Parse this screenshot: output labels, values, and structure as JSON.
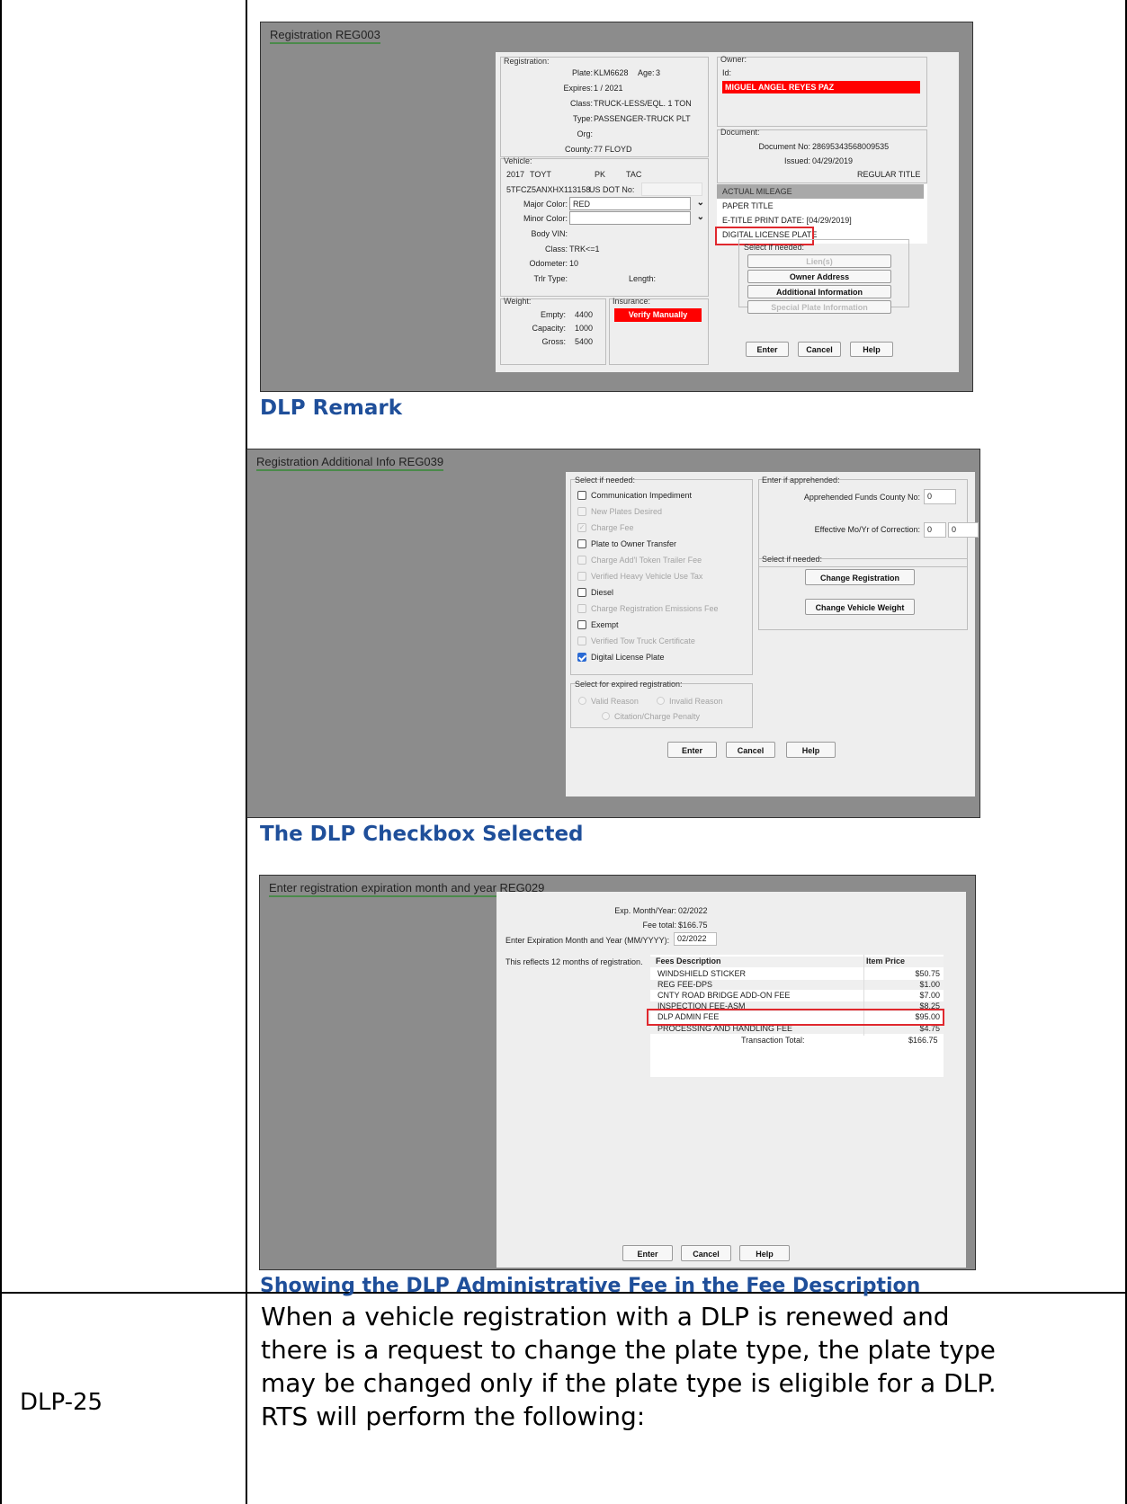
{
  "ss1": {
    "title": "Registration REG003",
    "registration": {
      "label": "Registration:",
      "plate_lbl": "Plate:",
      "plate": "KLM6628",
      "age_lbl": "Age:",
      "age": "3",
      "expires_lbl": "Expires:",
      "expires": "1  / 2021",
      "class_lbl": "Class:",
      "class": "TRUCK-LESS/EQL. 1 TON",
      "type_lbl": "Type:",
      "type": "PASSENGER-TRUCK PLT",
      "org_lbl": "Org:",
      "org": "",
      "county_lbl": "County:",
      "county": "77 FLOYD"
    },
    "vehicle": {
      "label": "Vehicle:",
      "year": "2017",
      "make": "TOYT",
      "body": "PK",
      "model": "TAC",
      "vin": "5TFCZ5ANXHX113158",
      "usdot_lbl": "US DOT No:",
      "major_color_lbl": "Major Color:",
      "major_color": "RED",
      "minor_color_lbl": "Minor Color:",
      "body_vin_lbl": "Body VIN:",
      "vclass_lbl": "Class:",
      "vclass": "TRK<=1",
      "odometer_lbl": "Odometer:",
      "odometer": "10",
      "trlr_lbl": "Trlr Type:",
      "length_lbl": "Length:"
    },
    "weight": {
      "label": "Weight:",
      "empty_lbl": "Empty:",
      "empty": "4400",
      "capacity_lbl": "Capacity:",
      "capacity": "1000",
      "gross_lbl": "Gross:",
      "gross": "5400"
    },
    "insurance": {
      "label": "Insurance:",
      "value": "Verify Manually"
    },
    "owner": {
      "label": "Owner:",
      "id_lbl": "Id:",
      "name": "MIGUEL ANGEL REYES PAZ"
    },
    "document": {
      "label": "Document:",
      "docno_lbl": "Document No:",
      "docno": "28695343568009535",
      "issued_lbl": "Issued:",
      "issued": "04/29/2019",
      "title_type": "REGULAR TITLE"
    },
    "remarks": [
      "ACTUAL MILEAGE",
      "PAPER TITLE",
      "E-TITLE PRINT DATE:  [04/29/2019]",
      "DIGITAL LICENSE PLATE"
    ],
    "select_label": "Select if needed:",
    "buttons": [
      "Lien(s)",
      "Owner Address",
      "Additional Information",
      "Special Plate Information"
    ],
    "enter": "Enter",
    "cancel": "Cancel",
    "help": "Help"
  },
  "caption1": "DLP Remark",
  "ss2": {
    "title": "Registration Additional Info REG039",
    "select_label": "Select if needed:",
    "checks": [
      {
        "label": "Communication Impediment",
        "state": "unchecked"
      },
      {
        "label": "New Plates Desired",
        "state": "disabled"
      },
      {
        "label": "Charge Fee",
        "state": "disabled-checked"
      },
      {
        "label": "Plate to Owner Transfer",
        "state": "unchecked"
      },
      {
        "label": "Charge Add'l Token Trailer Fee",
        "state": "disabled"
      },
      {
        "label": "Verified Heavy Vehicle Use Tax",
        "state": "disabled"
      },
      {
        "label": "Diesel",
        "state": "unchecked"
      },
      {
        "label": "Charge Registration Emissions Fee",
        "state": "disabled"
      },
      {
        "label": "Exempt",
        "state": "unchecked"
      },
      {
        "label": "Verified Tow Truck Certificate",
        "state": "disabled"
      },
      {
        "label": "Digital License Plate",
        "state": "checked"
      }
    ],
    "expired_label": "Select for expired registration:",
    "valid_reason": "Valid Reason",
    "invalid_reason": "Invalid Reason",
    "citation": "Citation/Charge Penalty",
    "apprehended_label": "Enter if apprehended:",
    "funds_county_lbl": "Apprehended Funds County No:",
    "funds_county": "0",
    "eff_lbl": "Effective Mo/Yr of Correction:",
    "eff_mo": "0",
    "eff_yr": "0",
    "select2_label": "Select if needed:",
    "change_reg": "Change Registration",
    "change_weight": "Change Vehicle Weight",
    "enter": "Enter",
    "cancel": "Cancel",
    "help": "Help"
  },
  "caption2": "The DLP Checkbox Selected",
  "ss3": {
    "title": "Enter registration expiration month and year REG029",
    "exp_lbl": "Exp. Month/Year:",
    "exp": "02/2022",
    "fee_lbl": "Fee total:",
    "fee": "$166.75",
    "enter_lbl": "Enter Expiration Month and Year (MM/YYYY):",
    "enter_val": "02/2022",
    "reflects": "This reflects 12 months of registration.",
    "col_desc": "Fees Description",
    "col_price": "Item Price",
    "fees": [
      {
        "desc": "WINDSHIELD STICKER",
        "price": "$50.75"
      },
      {
        "desc": "REG FEE-DPS",
        "price": "$1.00"
      },
      {
        "desc": "CNTY ROAD BRIDGE ADD-ON FEE",
        "price": "$7.00"
      },
      {
        "desc": "INSPECTION FEE-ASM",
        "price": "$8.25"
      },
      {
        "desc": "DLP ADMIN FEE",
        "price": "$95.00"
      },
      {
        "desc": "PROCESSING AND HANDLING FEE",
        "price": "$4.75"
      }
    ],
    "total_lbl": "Transaction Total:",
    "total": "$166.75",
    "enter": "Enter",
    "cancel": "Cancel",
    "help": "Help"
  },
  "caption3": "Showing the DLP Administrative Fee in the Fee Description",
  "row2": {
    "id": "DLP-25",
    "text1": "When a vehicle registration with a DLP is renewed and",
    "text2": "there is a request to change the plate type, the plate type",
    "text3": "may be changed only if the plate type is eligible for a DLP.",
    "text4": "RTS will perform the following:"
  }
}
